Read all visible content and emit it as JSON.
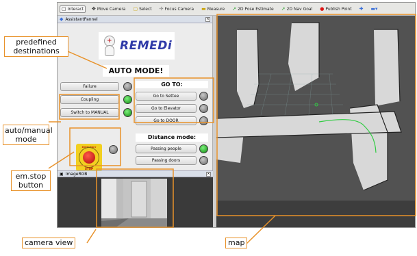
{
  "toolbar": {
    "items": [
      {
        "label": "Interact",
        "icon": "cursor-icon"
      },
      {
        "label": "Move Camera",
        "icon": "move-icon"
      },
      {
        "label": "Select",
        "icon": "select-box-icon"
      },
      {
        "label": "Focus Camera",
        "icon": "focus-icon"
      },
      {
        "label": "Measure",
        "icon": "ruler-icon"
      },
      {
        "label": "2D Pose Estimate",
        "icon": "green-arrow-icon"
      },
      {
        "label": "2D Nav Goal",
        "icon": "green-arrow-icon"
      },
      {
        "label": "Publish Point",
        "icon": "pin-icon"
      }
    ]
  },
  "assistant_panel": {
    "title": "AssistantPannel",
    "logo_text": "REMEDi",
    "mode_banner": "AUTO MODE!",
    "left_buttons": [
      {
        "label": "Failure",
        "led": "grey"
      },
      {
        "label": "Coupling",
        "led": "green"
      },
      {
        "label": "Switch to MANUAL",
        "led": "green"
      }
    ],
    "goto": {
      "title": "GO TO:",
      "buttons": [
        {
          "label": "Go to Settee",
          "led": "grey"
        },
        {
          "label": "Go to Elevator",
          "led": "grey"
        },
        {
          "label": "Go to DOOR",
          "led": "grey"
        }
      ]
    },
    "distance": {
      "title": "Distance mode:",
      "buttons": [
        {
          "label": "Passing people",
          "led": "green"
        },
        {
          "label": "Passing doors",
          "led": "grey"
        }
      ]
    },
    "estop": {
      "top_text": "EMERGENCY",
      "bottom_text": "STOP",
      "led": "grey"
    }
  },
  "image_panel": {
    "title": "ImageRGB"
  },
  "annotations": {
    "predefined": "predefined\ndestinations",
    "auto_manual": "auto/manual\nmode",
    "em_stop": "em.stop\nbutton",
    "camera": "camera view",
    "map": "map"
  },
  "colors": {
    "annotation": "#e8922a",
    "led_green": "#17a317",
    "logo_blue": "#2f3aa8"
  }
}
